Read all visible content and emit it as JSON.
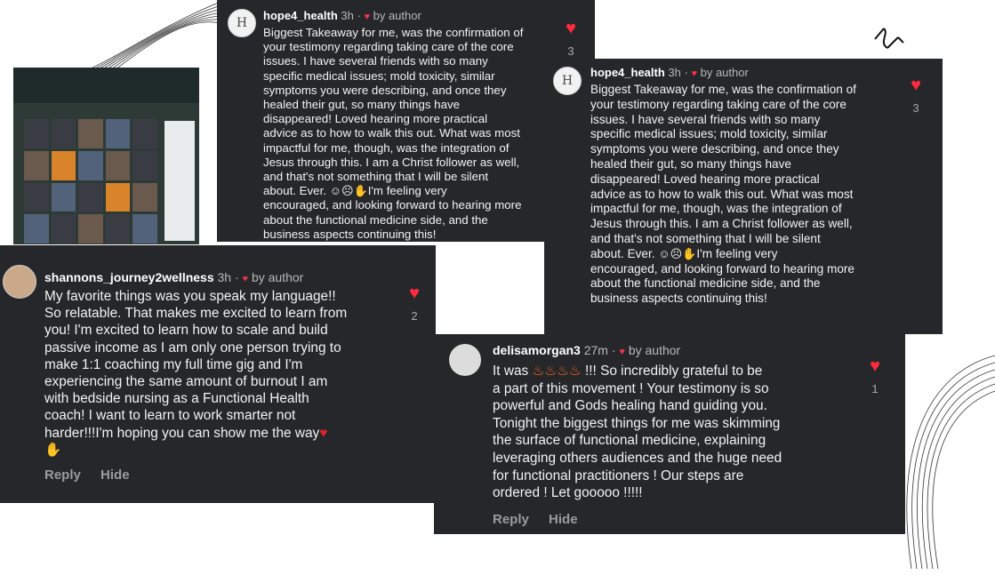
{
  "comments": [
    {
      "username": "hope4_health",
      "time": "3h",
      "author_label": "by author",
      "avatar_letter": "H",
      "lines": [
        "Biggest Takeaway for me, was the confirmation of",
        "your testimony regarding taking care of the core",
        "issues. I have several friends with so many",
        "specific medical issues; mold toxicity, similar",
        "symptoms you were describing, and once they",
        "healed their gut, so many things have",
        "disappeared! Loved hearing more practical",
        "advice as to how to walk this out. What was most",
        "impactful for me, though, was the integration of",
        "Jesus through this. I am a Christ follower as well,",
        "and that's not something that I will be silent",
        "about. Ever.",
        "encouraged, and looking forward to hearing more",
        "about the functional medicine side, and the",
        "business aspects continuing this!"
      ],
      "line12_tail": "I'm feeling very",
      "likes": "3"
    },
    {
      "username": "shannons_journey2wellness",
      "time": "3h",
      "author_label": "by author",
      "lines": [
        "My favorite things was you speak my language!!",
        "So relatable. That makes me excited to learn from",
        "you! I'm excited to learn how to scale and build",
        "passive income as I am only one person trying to",
        "make 1:1 coaching my full time gig and I'm",
        "experiencing the same amount of burnout I am",
        "with bedside nursing as a Functional Health",
        "coach! I want to learn to work smarter not",
        "harder!!!I'm hoping you can show me the way"
      ],
      "likes": "2",
      "reply": "Reply",
      "hide": "Hide"
    },
    {
      "username": "delisamorgan3",
      "time": "27m",
      "author_label": "by author",
      "line1_start": "It was",
      "line1_end": "!!! So incredibly grateful to be",
      "lines": [
        "a part of this movement ! Your testimony is so",
        "powerful and Gods healing hand guiding you.",
        "Tonight the biggest things for me was skimming",
        "the surface of functional medicine, explaining",
        "leveraging others audiences and the huge need",
        "for functional practitioners !  Our steps are",
        "ordered ! Let gooooo !!!!!"
      ],
      "likes": "1",
      "reply": "Reply",
      "hide": "Hide"
    }
  ],
  "icons": {
    "heart": "heart-icon",
    "emoji_smile": "smiling-face-icon",
    "emoji_pleading": "pleading-face-icon",
    "emoji_hands": "raised-hands-icon",
    "emoji_fire": "fire-icon"
  },
  "colors": {
    "card_bg": "#25272b",
    "heart": "#ff2a3d",
    "username": "#ffffff",
    "meta": "#b8b8b8"
  }
}
